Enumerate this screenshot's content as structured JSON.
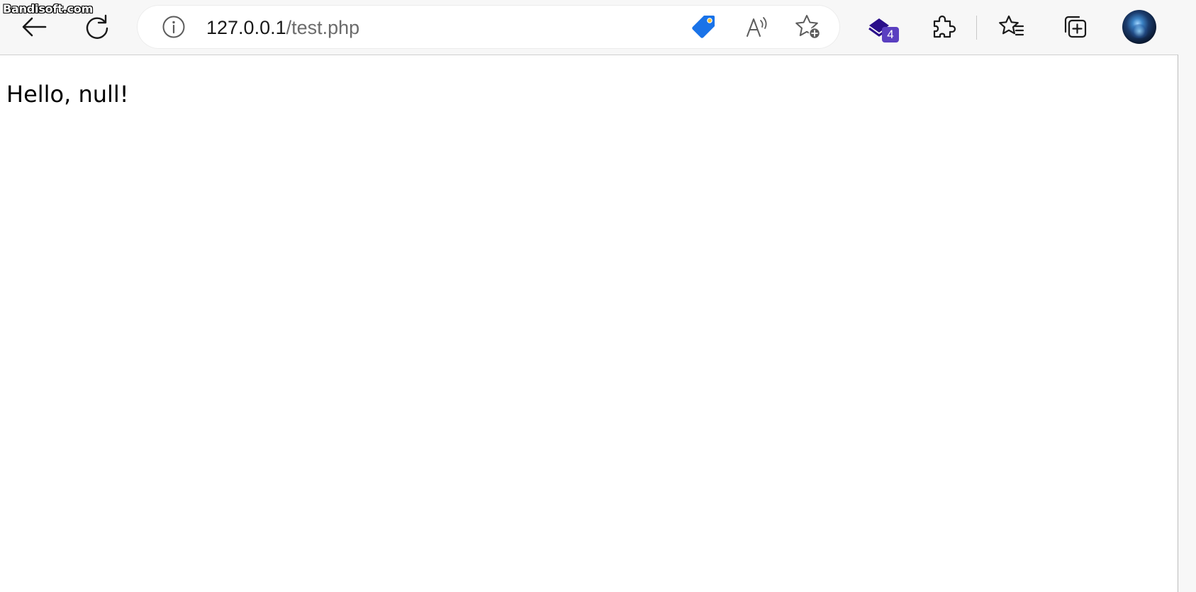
{
  "watermark": "Bandisoft.com",
  "toolbar": {
    "address": {
      "host": "127.0.0.1",
      "path": "/test.php"
    },
    "extension_badge": "4",
    "icons": {
      "back": "back-arrow-icon",
      "refresh": "refresh-icon",
      "site_info": "info-icon",
      "shopping": "price-tag-icon",
      "read_aloud": "read-aloud-icon",
      "add_favorite": "add-favorite-star-icon",
      "extension": "extension-stack-icon",
      "extensions": "puzzle-icon",
      "favorites": "favorites-star-list-icon",
      "collections": "collections-icon",
      "profile": "profile-avatar"
    },
    "colors": {
      "tag_blue": "#1a73e8",
      "extension_purple": "#3a1fa8",
      "badge_purple": "#5a3fc0"
    }
  },
  "page": {
    "body_text": "Hello, null!"
  }
}
